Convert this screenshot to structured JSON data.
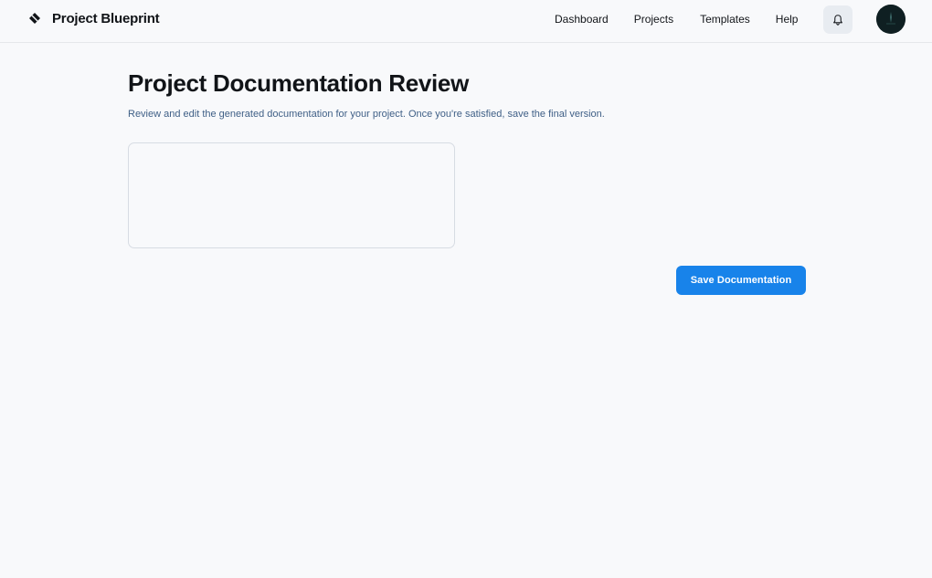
{
  "header": {
    "brand_icon": "diamond-logo-icon",
    "brand_title": "Project Blueprint",
    "nav": [
      {
        "label": "Dashboard"
      },
      {
        "label": "Projects"
      },
      {
        "label": "Templates"
      },
      {
        "label": "Help"
      }
    ],
    "notifications_icon": "bell-icon",
    "avatar_icon": "user-avatar-icon"
  },
  "main": {
    "title": "Project Documentation Review",
    "subtitle": "Review and edit the generated documentation for your project. Once you're satisfied, save the final version.",
    "editor": {
      "value": "",
      "placeholder": ""
    },
    "save_label": "Save Documentation"
  },
  "colors": {
    "background": "#f8f9fb",
    "accent": "#1883ea",
    "subtitle_text": "#3f5f86",
    "bell_button_bg": "#e8ecf1",
    "avatar_bg": "#0f1f22"
  }
}
